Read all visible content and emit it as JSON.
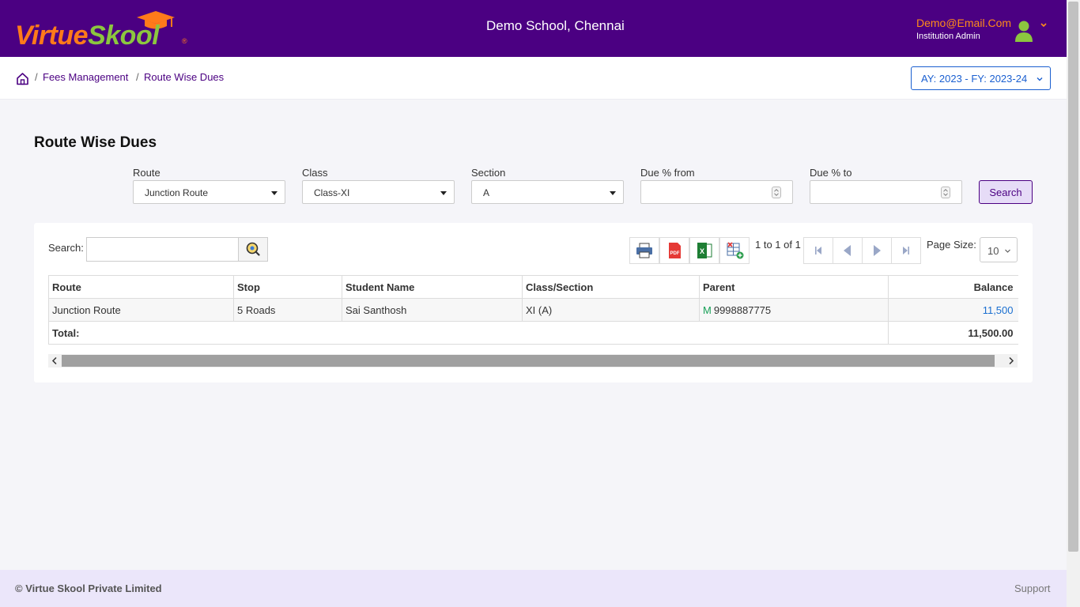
{
  "brand": {
    "logo_part1": "Virtue",
    "logo_part2": "Skool",
    "logo_mark": "®"
  },
  "header": {
    "school": "Demo School, Chennai",
    "user_email": "Demo@Email.Com",
    "user_role": "Institution Admin"
  },
  "breadcrumb": {
    "items": [
      "Fees Management",
      "Route Wise Dues"
    ],
    "separator": "/",
    "ay_selector": "AY: 2023 - FY: 2023-24"
  },
  "page": {
    "title": "Route Wise Dues"
  },
  "filters": {
    "route": {
      "label": "Route",
      "value": "Junction Route"
    },
    "class": {
      "label": "Class",
      "value": "Class-XI"
    },
    "section": {
      "label": "Section",
      "value": "A"
    },
    "due_from": {
      "label": "Due % from",
      "value": ""
    },
    "due_to": {
      "label": "Due % to",
      "value": ""
    },
    "search_button": "Search"
  },
  "grid": {
    "search_label": "Search:",
    "search_value": "",
    "pager_info": "1 to 1 of 1",
    "page_size_label": "Page Size:",
    "page_size": "10",
    "columns": [
      "Route",
      "Stop",
      "Student Name",
      "Class/Section",
      "Parent",
      "Balance"
    ],
    "rows": [
      {
        "route": "Junction Route",
        "stop": "5 Roads",
        "student": "Sai Santhosh",
        "class_section": "XI (A)",
        "parent_badge": "M",
        "parent_phone": "9998887775",
        "balance": "11,500"
      }
    ],
    "total_label": "Total:",
    "total_value": "11,500.00"
  },
  "footer": {
    "copyright": "© Virtue Skool Private Limited",
    "support": "Support"
  },
  "colors": {
    "header_bg": "#4b0082",
    "accent_orange": "#ff7a1a",
    "accent_green": "#8cc63f",
    "link_blue": "#1a6fd0",
    "footer_bg": "#ebe6fa"
  },
  "icons": [
    "home-icon",
    "user-avatar-icon",
    "chevron-down-icon",
    "search-icon",
    "print-icon",
    "pdf-icon",
    "excel-icon",
    "export-grid-icon",
    "first-page-icon",
    "prev-page-icon",
    "next-page-icon",
    "last-page-icon"
  ]
}
